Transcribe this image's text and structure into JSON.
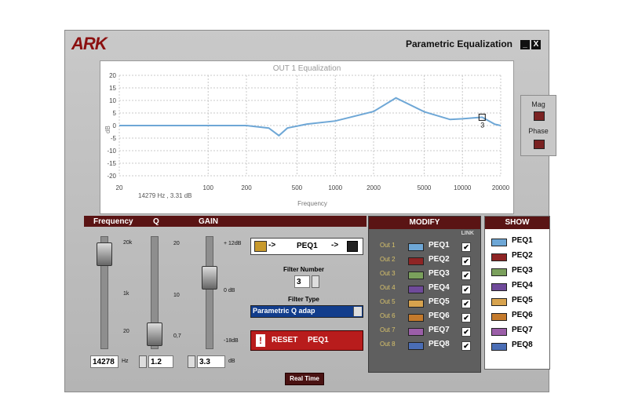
{
  "window": {
    "brand": "ARK",
    "title": "Parametric Equalization",
    "minimize_label": "_",
    "close_label": "X"
  },
  "graph": {
    "title": "OUT 1 Equalization",
    "ylabel": "dB",
    "xlabel": "Frequency",
    "readout": "14279 Hz , 3.31 dB",
    "y_ticks": [
      "20",
      "15",
      "10",
      "5",
      "0",
      "-5",
      "-10",
      "-15",
      "-20"
    ],
    "x_ticks": [
      "20",
      "100",
      "200",
      "500",
      "1000",
      "2000",
      "5000",
      "10000",
      "20000"
    ],
    "marker_label": "3"
  },
  "chart_data": {
    "type": "line",
    "xlabel": "Frequency",
    "ylabel": "dB",
    "ylim": [
      -20,
      20
    ],
    "xscale": "log",
    "grid": true,
    "x": [
      20,
      100,
      200,
      300,
      360,
      420,
      600,
      1000,
      2000,
      3000,
      5000,
      8000,
      10000,
      14279,
      18000,
      20000
    ],
    "y": [
      0,
      0,
      0,
      -1,
      -4,
      -1,
      0.6,
      1.8,
      5.6,
      11,
      5.5,
      2.4,
      2.7,
      3.31,
      0.5,
      0
    ]
  },
  "display": {
    "mag_label": "Mag",
    "phase_label": "Phase"
  },
  "sliders": {
    "freq_header": "Frequency",
    "q_header": "Q",
    "gain_header": "GAIN",
    "freq_top": "20k",
    "freq_mid": "1k",
    "freq_low": "20",
    "q_top": "20",
    "q_mid": "10",
    "q_low": "0,7",
    "gain_top": "+ 12dB",
    "gain_mid": "0 dB",
    "gain_low": "-18dB",
    "freq_value": "14278",
    "freq_unit": "Hz",
    "q_value": "1.2",
    "gain_value": "3.3",
    "gain_unit": "dB"
  },
  "filter": {
    "arrow_left": "->",
    "peq_label": "PEQ1",
    "arrow_right": "->",
    "number_label": "Filter Number",
    "number_value": "3",
    "type_label": "Filter Type",
    "type_value": "Parametric Q adap",
    "reset_label": "RESET",
    "reset_target": "PEQ1"
  },
  "modify": {
    "header": "MODIFY",
    "link_label": "LINK",
    "rows": [
      {
        "out": "Out 1",
        "peq": "PEQ1",
        "color": "#6ea7d6",
        "check": "✔"
      },
      {
        "out": "Out 2",
        "peq": "PEQ2",
        "color": "#8e2424",
        "check": "✔"
      },
      {
        "out": "Out 3",
        "peq": "PEQ3",
        "color": "#7aa05c",
        "check": "✔"
      },
      {
        "out": "Out 4",
        "peq": "PEQ4",
        "color": "#6f4a9a",
        "check": "✔"
      },
      {
        "out": "Out 5",
        "peq": "PEQ5",
        "color": "#d7a34e",
        "check": "✔"
      },
      {
        "out": "Out 6",
        "peq": "PEQ6",
        "color": "#c47a2c",
        "check": "✔"
      },
      {
        "out": "Out 7",
        "peq": "PEQ7",
        "color": "#9b5ea8",
        "check": "✔"
      },
      {
        "out": "Out 8",
        "peq": "PEQ8",
        "color": "#4a6db5",
        "check": "✔"
      }
    ]
  },
  "show": {
    "header": "SHOW",
    "rows": [
      {
        "peq": "PEQ1",
        "color": "#6ea7d6"
      },
      {
        "peq": "PEQ2",
        "color": "#8e2424"
      },
      {
        "peq": "PEQ3",
        "color": "#7aa05c"
      },
      {
        "peq": "PEQ4",
        "color": "#6f4a9a"
      },
      {
        "peq": "PEQ5",
        "color": "#d7a34e"
      },
      {
        "peq": "PEQ6",
        "color": "#c47a2c"
      },
      {
        "peq": "PEQ7",
        "color": "#9b5ea8"
      },
      {
        "peq": "PEQ8",
        "color": "#4a6db5"
      }
    ]
  },
  "realtime_label": "Real Time"
}
